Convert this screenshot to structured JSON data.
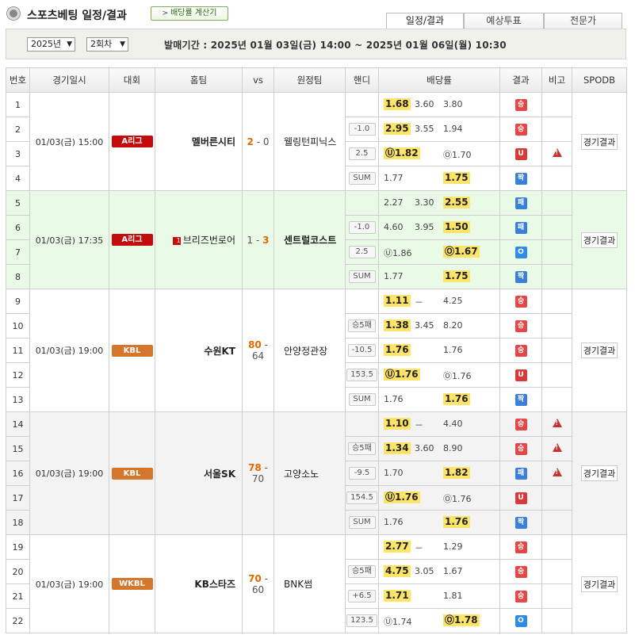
{
  "header": {
    "title": "스포츠베팅 일정/결과",
    "calc_button": "배당률 계산기",
    "calc_arrow": ">",
    "tabs": [
      "일정/결과",
      "예상투표",
      "전문가"
    ]
  },
  "filters": {
    "year": "2025년",
    "round": "2회차",
    "period": "발매기간 : 2025년 01월 03일(금) 14:00 ~ 2025년 01월 06일(월) 10:30"
  },
  "table": {
    "headers": [
      "번호",
      "경기일시",
      "대회",
      "홈팀",
      "vs",
      "원정팀",
      "핸디",
      "배당률",
      "결과",
      "비고",
      "SPODB"
    ],
    "games": [
      {
        "date": "01/03(금) 15:00",
        "league": "A리그",
        "league_color": "#c40c0c",
        "home": "멜버른시티",
        "home_score": "2",
        "away_score": "0",
        "winner": "home",
        "away": "웰링턴피닉스",
        "home_flag": "",
        "link": "경기결과",
        "bg": "white",
        "rows": [
          {
            "no": "1",
            "handi": "",
            "odds": [
              "1.68",
              "3.60",
              "3.80"
            ],
            "hl": 0,
            "result": "승",
            "rc": "#e74646",
            "warn": false
          },
          {
            "no": "2",
            "handi": "-1.0",
            "odds": [
              "2.95",
              "3.55",
              "1.94"
            ],
            "hl": 0,
            "result": "승",
            "rc": "#e74646",
            "warn": false
          },
          {
            "no": "3",
            "handi": "2.5",
            "odds": [
              "Ⓤ1.82",
              "",
              "Ⓞ1.70"
            ],
            "hl": 0,
            "result": "U",
            "rc": "#d83a3a",
            "warn": true
          },
          {
            "no": "4",
            "handi": "SUM",
            "odds": [
              "1.77",
              "",
              "1.75"
            ],
            "hl": 2,
            "result": "짝",
            "rc": "#3b7fdb",
            "warn": false
          }
        ]
      },
      {
        "date": "01/03(금) 17:35",
        "league": "A리그",
        "league_color": "#c40c0c",
        "home": "브리즈번로어",
        "home_score": "1",
        "away_score": "3",
        "winner": "away",
        "away": "센트럴코스트",
        "home_flag": "1",
        "link": "경기결과",
        "bg": "green",
        "rows": [
          {
            "no": "5",
            "handi": "",
            "odds": [
              "2.27",
              "3.30",
              "2.55"
            ],
            "hl": 2,
            "result": "패",
            "rc": "#3b7fdb",
            "warn": false
          },
          {
            "no": "6",
            "handi": "-1.0",
            "odds": [
              "4.60",
              "3.95",
              "1.50"
            ],
            "hl": 2,
            "result": "패",
            "rc": "#3b7fdb",
            "warn": false
          },
          {
            "no": "7",
            "handi": "2.5",
            "odds": [
              "Ⓤ1.86",
              "",
              "Ⓞ1.67"
            ],
            "hl": 2,
            "result": "O",
            "rc": "#2f8be6",
            "warn": false
          },
          {
            "no": "8",
            "handi": "SUM",
            "odds": [
              "1.77",
              "",
              "1.75"
            ],
            "hl": 2,
            "result": "짝",
            "rc": "#3b7fdb",
            "warn": false
          }
        ]
      },
      {
        "date": "01/03(금) 19:00",
        "league": "KBL",
        "league_color": "#d4772c",
        "home": "수원KT",
        "home_score": "80",
        "away_score": "64",
        "winner": "home",
        "away": "안양정관장",
        "home_flag": "",
        "link": "경기결과",
        "bg": "white",
        "rows": [
          {
            "no": "9",
            "handi": "",
            "odds": [
              "1.11",
              "－",
              "4.25"
            ],
            "hl": 0,
            "result": "승",
            "rc": "#e74646",
            "warn": false
          },
          {
            "no": "10",
            "handi": "승5패",
            "odds": [
              "1.38",
              "3.45",
              "8.20"
            ],
            "hl": 0,
            "result": "승",
            "rc": "#e74646",
            "warn": false
          },
          {
            "no": "11",
            "handi": "-10.5",
            "odds": [
              "1.76",
              "",
              "1.76"
            ],
            "hl": 0,
            "result": "승",
            "rc": "#e74646",
            "warn": false
          },
          {
            "no": "12",
            "handi": "153.5",
            "odds": [
              "Ⓤ1.76",
              "",
              "Ⓞ1.76"
            ],
            "hl": 0,
            "result": "U",
            "rc": "#d83a3a",
            "warn": false
          },
          {
            "no": "13",
            "handi": "SUM",
            "odds": [
              "1.76",
              "",
              "1.76"
            ],
            "hl": 2,
            "result": "짝",
            "rc": "#3b7fdb",
            "warn": false
          }
        ]
      },
      {
        "date": "01/03(금) 19:00",
        "league": "KBL",
        "league_color": "#d4772c",
        "home": "서울SK",
        "home_score": "78",
        "away_score": "70",
        "winner": "home",
        "away": "고양소노",
        "home_flag": "",
        "link": "경기결과",
        "bg": "gray",
        "rows": [
          {
            "no": "14",
            "handi": "",
            "odds": [
              "1.10",
              "－",
              "4.40"
            ],
            "hl": 0,
            "result": "승",
            "rc": "#e74646",
            "warn": true
          },
          {
            "no": "15",
            "handi": "승5패",
            "odds": [
              "1.34",
              "3.60",
              "8.90"
            ],
            "hl": 0,
            "result": "승",
            "rc": "#e74646",
            "warn": true
          },
          {
            "no": "16",
            "handi": "-9.5",
            "odds": [
              "1.70",
              "",
              "1.82"
            ],
            "hl": 2,
            "result": "패",
            "rc": "#3b7fdb",
            "warn": true
          },
          {
            "no": "17",
            "handi": "154.5",
            "odds": [
              "Ⓤ1.76",
              "",
              "Ⓞ1.76"
            ],
            "hl": 0,
            "result": "U",
            "rc": "#d83a3a",
            "warn": false
          },
          {
            "no": "18",
            "handi": "SUM",
            "odds": [
              "1.76",
              "",
              "1.76"
            ],
            "hl": 2,
            "result": "짝",
            "rc": "#3b7fdb",
            "warn": false
          }
        ]
      },
      {
        "date": "01/03(금) 19:00",
        "league": "WKBL",
        "league_color": "#d4772c",
        "home": "KB스타즈",
        "home_score": "70",
        "away_score": "60",
        "winner": "home",
        "away": "BNK썸",
        "home_flag": "",
        "link": "경기결과",
        "bg": "white",
        "rows": [
          {
            "no": "19",
            "handi": "",
            "odds": [
              "2.77",
              "－",
              "1.29"
            ],
            "hl": 0,
            "result": "승",
            "rc": "#e74646",
            "warn": false
          },
          {
            "no": "20",
            "handi": "승5패",
            "odds": [
              "4.75",
              "3.05",
              "1.67"
            ],
            "hl": 0,
            "result": "승",
            "rc": "#e74646",
            "warn": false
          },
          {
            "no": "21",
            "handi": "+6.5",
            "odds": [
              "1.71",
              "",
              "1.81"
            ],
            "hl": 0,
            "result": "승",
            "rc": "#e74646",
            "warn": false
          },
          {
            "no": "22",
            "handi": "123.5",
            "odds": [
              "Ⓤ1.74",
              "",
              "Ⓞ1.78"
            ],
            "hl": 2,
            "result": "O",
            "rc": "#2f8be6",
            "warn": false
          }
        ]
      }
    ]
  }
}
